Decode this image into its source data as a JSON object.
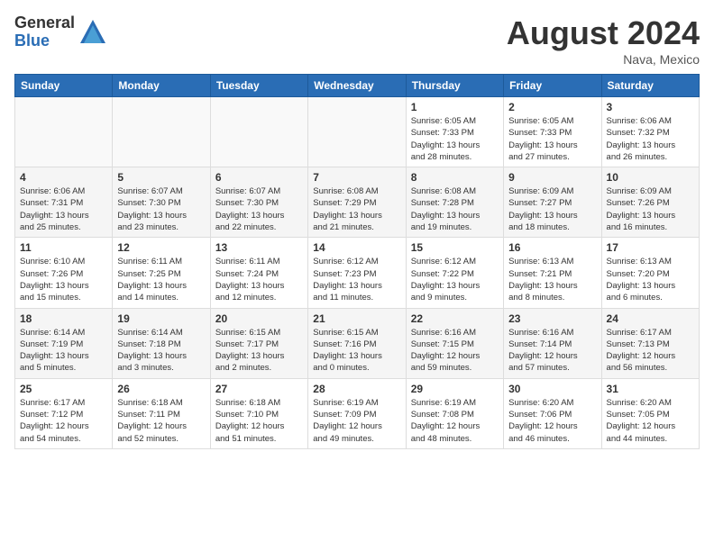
{
  "logo": {
    "general": "General",
    "blue": "Blue"
  },
  "header": {
    "month_year": "August 2024",
    "location": "Nava, Mexico"
  },
  "weekdays": [
    "Sunday",
    "Monday",
    "Tuesday",
    "Wednesday",
    "Thursday",
    "Friday",
    "Saturday"
  ],
  "weeks": [
    [
      {
        "day": "",
        "info": ""
      },
      {
        "day": "",
        "info": ""
      },
      {
        "day": "",
        "info": ""
      },
      {
        "day": "",
        "info": ""
      },
      {
        "day": "1",
        "info": "Sunrise: 6:05 AM\nSunset: 7:33 PM\nDaylight: 13 hours\nand 28 minutes."
      },
      {
        "day": "2",
        "info": "Sunrise: 6:05 AM\nSunset: 7:33 PM\nDaylight: 13 hours\nand 27 minutes."
      },
      {
        "day": "3",
        "info": "Sunrise: 6:06 AM\nSunset: 7:32 PM\nDaylight: 13 hours\nand 26 minutes."
      }
    ],
    [
      {
        "day": "4",
        "info": "Sunrise: 6:06 AM\nSunset: 7:31 PM\nDaylight: 13 hours\nand 25 minutes."
      },
      {
        "day": "5",
        "info": "Sunrise: 6:07 AM\nSunset: 7:30 PM\nDaylight: 13 hours\nand 23 minutes."
      },
      {
        "day": "6",
        "info": "Sunrise: 6:07 AM\nSunset: 7:30 PM\nDaylight: 13 hours\nand 22 minutes."
      },
      {
        "day": "7",
        "info": "Sunrise: 6:08 AM\nSunset: 7:29 PM\nDaylight: 13 hours\nand 21 minutes."
      },
      {
        "day": "8",
        "info": "Sunrise: 6:08 AM\nSunset: 7:28 PM\nDaylight: 13 hours\nand 19 minutes."
      },
      {
        "day": "9",
        "info": "Sunrise: 6:09 AM\nSunset: 7:27 PM\nDaylight: 13 hours\nand 18 minutes."
      },
      {
        "day": "10",
        "info": "Sunrise: 6:09 AM\nSunset: 7:26 PM\nDaylight: 13 hours\nand 16 minutes."
      }
    ],
    [
      {
        "day": "11",
        "info": "Sunrise: 6:10 AM\nSunset: 7:26 PM\nDaylight: 13 hours\nand 15 minutes."
      },
      {
        "day": "12",
        "info": "Sunrise: 6:11 AM\nSunset: 7:25 PM\nDaylight: 13 hours\nand 14 minutes."
      },
      {
        "day": "13",
        "info": "Sunrise: 6:11 AM\nSunset: 7:24 PM\nDaylight: 13 hours\nand 12 minutes."
      },
      {
        "day": "14",
        "info": "Sunrise: 6:12 AM\nSunset: 7:23 PM\nDaylight: 13 hours\nand 11 minutes."
      },
      {
        "day": "15",
        "info": "Sunrise: 6:12 AM\nSunset: 7:22 PM\nDaylight: 13 hours\nand 9 minutes."
      },
      {
        "day": "16",
        "info": "Sunrise: 6:13 AM\nSunset: 7:21 PM\nDaylight: 13 hours\nand 8 minutes."
      },
      {
        "day": "17",
        "info": "Sunrise: 6:13 AM\nSunset: 7:20 PM\nDaylight: 13 hours\nand 6 minutes."
      }
    ],
    [
      {
        "day": "18",
        "info": "Sunrise: 6:14 AM\nSunset: 7:19 PM\nDaylight: 13 hours\nand 5 minutes."
      },
      {
        "day": "19",
        "info": "Sunrise: 6:14 AM\nSunset: 7:18 PM\nDaylight: 13 hours\nand 3 minutes."
      },
      {
        "day": "20",
        "info": "Sunrise: 6:15 AM\nSunset: 7:17 PM\nDaylight: 13 hours\nand 2 minutes."
      },
      {
        "day": "21",
        "info": "Sunrise: 6:15 AM\nSunset: 7:16 PM\nDaylight: 13 hours\nand 0 minutes."
      },
      {
        "day": "22",
        "info": "Sunrise: 6:16 AM\nSunset: 7:15 PM\nDaylight: 12 hours\nand 59 minutes."
      },
      {
        "day": "23",
        "info": "Sunrise: 6:16 AM\nSunset: 7:14 PM\nDaylight: 12 hours\nand 57 minutes."
      },
      {
        "day": "24",
        "info": "Sunrise: 6:17 AM\nSunset: 7:13 PM\nDaylight: 12 hours\nand 56 minutes."
      }
    ],
    [
      {
        "day": "25",
        "info": "Sunrise: 6:17 AM\nSunset: 7:12 PM\nDaylight: 12 hours\nand 54 minutes."
      },
      {
        "day": "26",
        "info": "Sunrise: 6:18 AM\nSunset: 7:11 PM\nDaylight: 12 hours\nand 52 minutes."
      },
      {
        "day": "27",
        "info": "Sunrise: 6:18 AM\nSunset: 7:10 PM\nDaylight: 12 hours\nand 51 minutes."
      },
      {
        "day": "28",
        "info": "Sunrise: 6:19 AM\nSunset: 7:09 PM\nDaylight: 12 hours\nand 49 minutes."
      },
      {
        "day": "29",
        "info": "Sunrise: 6:19 AM\nSunset: 7:08 PM\nDaylight: 12 hours\nand 48 minutes."
      },
      {
        "day": "30",
        "info": "Sunrise: 6:20 AM\nSunset: 7:06 PM\nDaylight: 12 hours\nand 46 minutes."
      },
      {
        "day": "31",
        "info": "Sunrise: 6:20 AM\nSunset: 7:05 PM\nDaylight: 12 hours\nand 44 minutes."
      }
    ]
  ]
}
